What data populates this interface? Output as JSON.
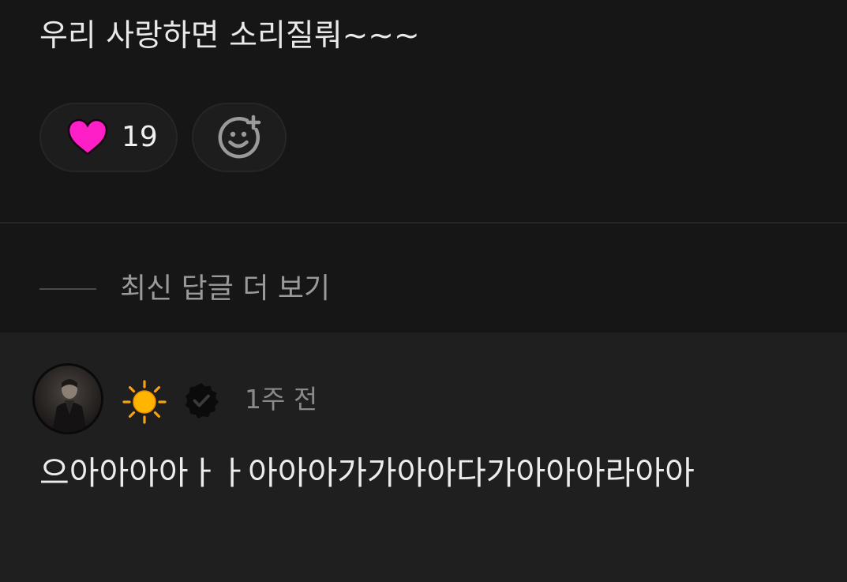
{
  "post": {
    "text": "우리 사랑하면 소리질뤄~~~"
  },
  "reactions": {
    "like_count": "19",
    "like_icon": "heart-icon",
    "add_reaction_icon": "add-reaction-smile-icon",
    "heart_color": "#ff1fc7"
  },
  "replies": {
    "more_label": "최신 답글 더 보기"
  },
  "reply": {
    "username_emoji": "☀️",
    "verified_icon": "verified-badge-icon",
    "time_ago": "1주 전",
    "text": "으아아아아ㅏㅏ아아아가가아아다가아아아라아아"
  }
}
